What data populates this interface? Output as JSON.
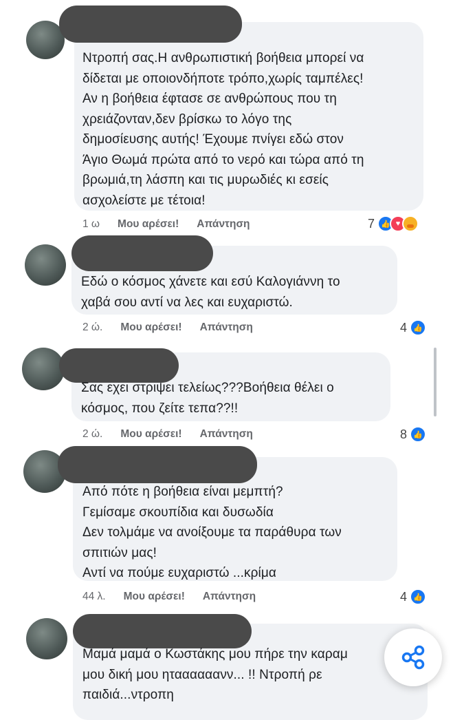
{
  "comments": [
    {
      "text": "Ντροπή σας.Η ανθρωπιστική βοήθεια μπορεί να\nδίδεται με οποιονδήποτε τρόπο,χωρίς ταμπέλες!\nΑν η βοήθεια έφτασε σε ανθρώπους που τη\nχρειάζονταν,δεν βρίσκω το λόγο της\nδημοσίευσης αυτής! Έχουμε πνίγει εδώ στον\nΆγιο Θωμά πρώτα από το νερό και τώρα από τη\nβρωμιά,τη λάσπη και τις μυρωδιές κι εσείς\nασχολείστε με τέτοια!",
      "time": "1 ω",
      "like_label": "Μου αρέσει!",
      "reply_label": "Απάντηση",
      "reactions_count": "7"
    },
    {
      "text": "Εδώ ο κόσμος χάνετε και εσύ Καλογιάννη το\nχαβά σου αντί να λες και ευχαριστώ.",
      "time": "2 ώ.",
      "like_label": "Μου αρέσει!",
      "reply_label": "Απάντηση",
      "reactions_count": "4"
    },
    {
      "text": "Σας εχει στριψει τελείως???Βοήθεια θέλει ο\nκόσμος, που ζείτε τεπα??!!",
      "time": "2 ώ.",
      "like_label": "Μου αρέσει!",
      "reply_label": "Απάντηση",
      "reactions_count": "8"
    },
    {
      "text": "Από πότε η βοήθεια είναι μεμπτή?\nΓεμίσαμε σκουπίδια και δυσωδία\nΔεν τολμάμε να ανοίξουμε τα παράθυρα των\nσπιτιών μας!\nΑντί να πούμε ευχαριστώ ...κρίμα",
      "time": "44 λ.",
      "like_label": "Μου αρέσει!",
      "reply_label": "Απάντηση",
      "reactions_count": "4"
    },
    {
      "text": "Μαμά μαμά ο Κωστάκης μου πήρε την καραμ\nμου δική μου ηταααααανν... !! Ντροπή ρε\nπαιδιά...ντροπη"
    }
  ],
  "icons": {
    "like": "like-icon",
    "love": "love-icon",
    "care": "care-icon",
    "share": "share-icon"
  },
  "colors": {
    "bubble": "#f0f2f5",
    "meta_text": "#65676b",
    "like_blue": "#1877f2",
    "love_red": "#f33e58"
  }
}
